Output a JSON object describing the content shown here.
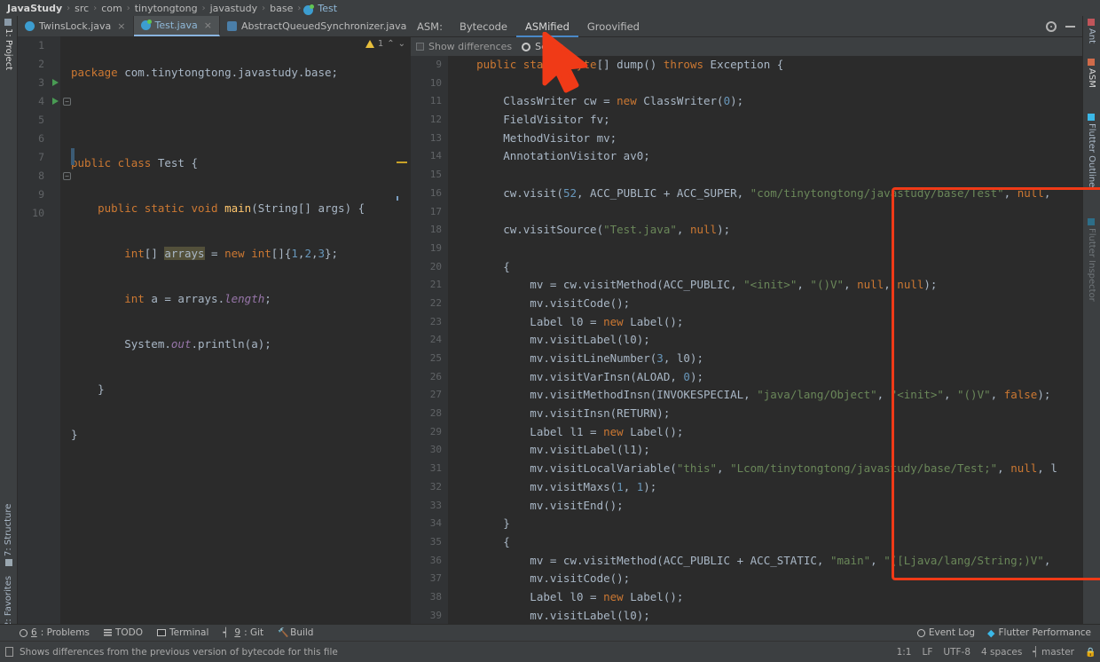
{
  "breadcrumb": {
    "items": [
      "JavaStudy",
      "src",
      "com",
      "tinytongtong",
      "javastudy",
      "base",
      "Test"
    ],
    "separator": "›"
  },
  "editor": {
    "tabs": [
      {
        "label": "TwinsLock.java",
        "close": "×",
        "active": false
      },
      {
        "label": "Test.java",
        "close": "×",
        "active": true
      },
      {
        "label": "AbstractQueuedSynchronizer.java",
        "close": "×",
        "active": false
      }
    ],
    "inspection": {
      "count": "1",
      "up": "⌃",
      "down": "⌄"
    },
    "line_numbers": [
      "1",
      "2",
      "3",
      "4",
      "5",
      "6",
      "7",
      "8",
      "9",
      "10"
    ],
    "code": [
      "package com.tinytongtong.javastudy.base;",
      "",
      "public class Test {",
      "    public static void main(String[] args) {",
      "        int[] arrays = new int[]{1,2,3};",
      "        int a = arrays.length;",
      "        System.out.println(a);",
      "    }",
      "}",
      ""
    ]
  },
  "asm_panel": {
    "label": "ASM:",
    "tabs": [
      {
        "label": "Bytecode",
        "active": false
      },
      {
        "label": "ASMified",
        "active": true
      },
      {
        "label": "Groovified",
        "active": false
      }
    ],
    "toolbar": {
      "show_differences": "Show differences",
      "settings": "Settin"
    },
    "gear_icon": "gear-icon",
    "minimize_icon": "minimize-icon",
    "line_numbers": [
      "9",
      "10",
      "11",
      "12",
      "13",
      "14",
      "15",
      "16",
      "17",
      "18",
      "19",
      "20",
      "21",
      "22",
      "23",
      "24",
      "25",
      "26",
      "27",
      "28",
      "29",
      "30",
      "31",
      "32",
      "33",
      "34",
      "35",
      "36",
      "37",
      "38",
      "39"
    ],
    "code": [
      "    public static byte[] dump() throws Exception {",
      "",
      "        ClassWriter cw = new ClassWriter(0);",
      "        FieldVisitor fv;",
      "        MethodVisitor mv;",
      "        AnnotationVisitor av0;",
      "",
      "        cw.visit(52, ACC_PUBLIC + ACC_SUPER, \"com/tinytongtong/javastudy/base/Test\", null,",
      "",
      "        cw.visitSource(\"Test.java\", null);",
      "",
      "        {",
      "            mv = cw.visitMethod(ACC_PUBLIC, \"<init>\", \"()V\", null, null);",
      "            mv.visitCode();",
      "            Label l0 = new Label();",
      "            mv.visitLabel(l0);",
      "            mv.visitLineNumber(3, l0);",
      "            mv.visitVarInsn(ALOAD, 0);",
      "            mv.visitMethodInsn(INVOKESPECIAL, \"java/lang/Object\", \"<init>\", \"()V\", false);",
      "            mv.visitInsn(RETURN);",
      "            Label l1 = new Label();",
      "            mv.visitLabel(l1);",
      "            mv.visitLocalVariable(\"this\", \"Lcom/tinytongtong/javastudy/base/Test;\", null, l",
      "            mv.visitMaxs(1, 1);",
      "            mv.visitEnd();",
      "        }",
      "        {",
      "            mv = cw.visitMethod(ACC_PUBLIC + ACC_STATIC, \"main\", \"([Ljava/lang/String;)V\",",
      "            mv.visitCode();",
      "            Label l0 = new Label();",
      "            mv.visitLabel(l0);"
    ]
  },
  "left_stripe": {
    "top": [
      {
        "label": "1: Project",
        "active": true
      }
    ],
    "bottom": [
      {
        "label": "7: Structure",
        "active": false
      },
      {
        "label": "2: Favorites",
        "active": false
      }
    ]
  },
  "right_stripe": [
    {
      "label": "Ant",
      "active": false
    },
    {
      "label": "ASM",
      "active": true
    },
    {
      "label": "Flutter Outline",
      "active": false
    },
    {
      "label": "Flutter Inspector",
      "active": false
    }
  ],
  "tool_window_bar": {
    "left": [
      {
        "num": "6",
        "label": ": Problems",
        "icon": "problems-icon"
      },
      {
        "num": "",
        "label": "TODO",
        "icon": "todo-icon"
      },
      {
        "num": "",
        "label": "Terminal",
        "icon": "terminal-icon"
      },
      {
        "num": "9",
        "label": ": Git",
        "icon": "git-icon"
      },
      {
        "num": "",
        "label": "Build",
        "icon": "build-icon"
      }
    ],
    "right": [
      {
        "label": "Event Log",
        "icon": "event-log-icon"
      },
      {
        "label": "Flutter Performance",
        "icon": "flutter-icon"
      }
    ]
  },
  "status_bar": {
    "message": "Shows differences from the previous version of bytecode for this file",
    "position": "1:1",
    "line_sep": "LF",
    "encoding": "UTF-8",
    "indent": "4 spaces",
    "branch": "master",
    "lock_icon": "lock-icon"
  },
  "colors": {
    "accent": "#4a88c7",
    "annotation": "#f03a17",
    "keyword": "#cc7832",
    "string": "#6a8759",
    "number": "#6897bb",
    "method": "#ffc66d",
    "field": "#9876aa",
    "editor_bg": "#2b2b2b",
    "chrome_bg": "#3c3f41"
  }
}
